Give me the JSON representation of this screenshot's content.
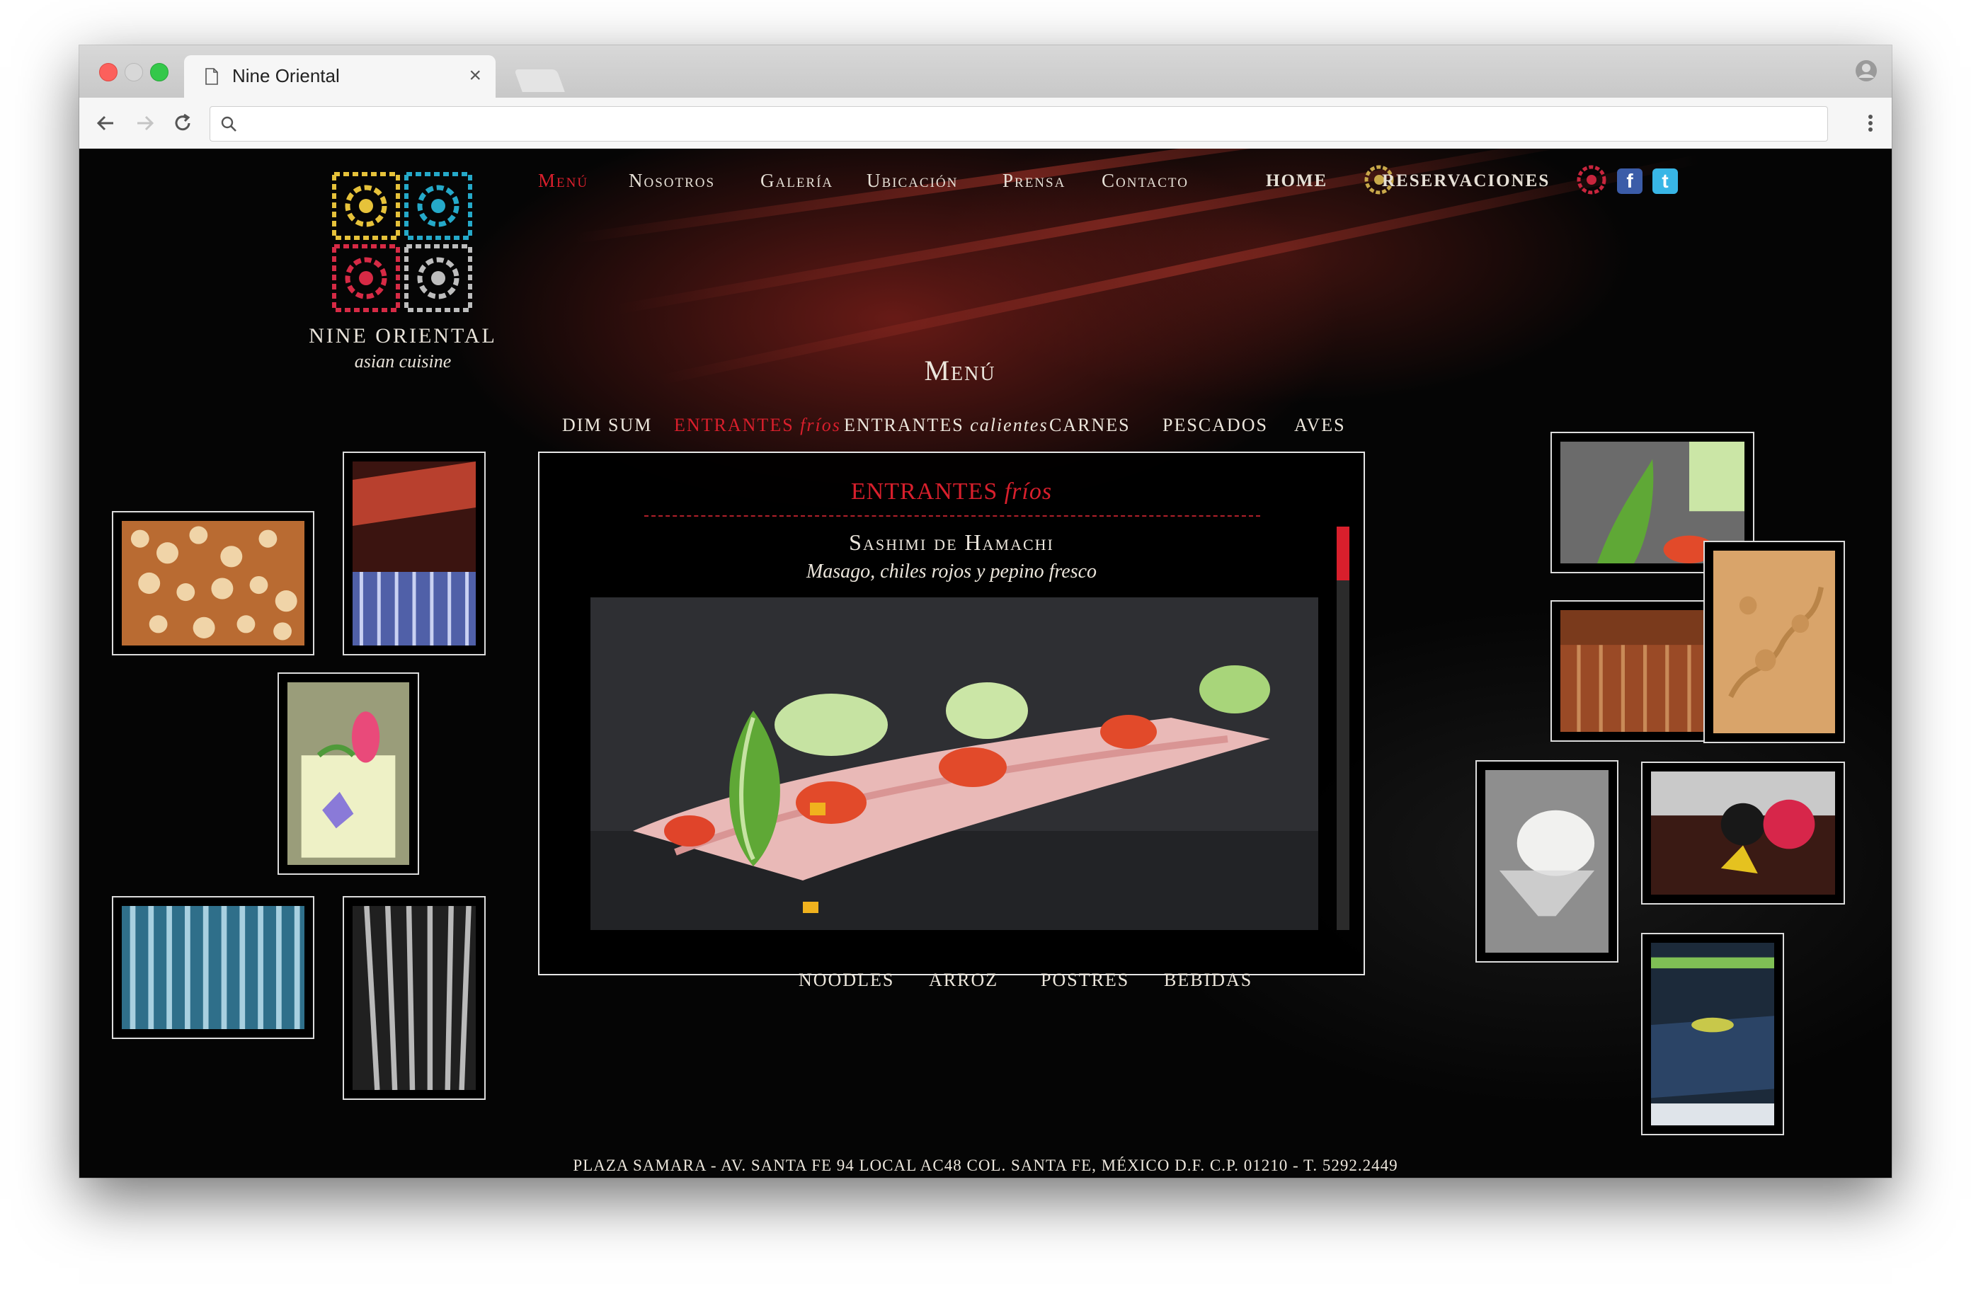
{
  "browser": {
    "tab_title": "Nine Oriental",
    "tab_close": "×",
    "url": "",
    "back_icon": "arrow-left-icon",
    "forward_icon": "arrow-right-icon",
    "reload_icon": "reload-icon",
    "search_icon": "search-icon",
    "menu_icon": "kebab-menu-icon",
    "profile_icon": "profile-icon"
  },
  "brand": {
    "name": "NINE ORIENTAL",
    "tagline": "asian cuisine",
    "colors": [
      "#e6c23a",
      "#25a9c9",
      "#d62a45",
      "#bdbdbd"
    ]
  },
  "top_nav": {
    "items": [
      {
        "label": "Menú",
        "active": true
      },
      {
        "label": "Nosotros",
        "active": false
      },
      {
        "label": "Galería",
        "active": false
      },
      {
        "label": "Ubicación",
        "active": false
      },
      {
        "label": "Prensa",
        "active": false
      },
      {
        "label": "Contacto",
        "active": false
      }
    ],
    "home": "HOME",
    "reservations": "RESERVACIONES",
    "facebook": "f",
    "twitter": "t"
  },
  "menu": {
    "heading": "Menú",
    "categories": [
      {
        "label": "DIM SUM",
        "italic": "",
        "active": false
      },
      {
        "label": "ENTRANTES",
        "italic": "fríos",
        "active": true
      },
      {
        "label": "ENTRANTES",
        "italic": "calientes",
        "active": false
      },
      {
        "label": "CARNES",
        "italic": "",
        "active": false
      },
      {
        "label": "PESCADOS",
        "italic": "",
        "active": false
      },
      {
        "label": "AVES",
        "italic": "",
        "active": false
      }
    ],
    "bottom_categories": [
      "NOODLES",
      "ARROZ",
      "POSTRES",
      "BEBIDAS"
    ],
    "panel": {
      "title": "ENTRANTES",
      "title_italic": "fríos",
      "dish_name": "Sashimi de Hamachi",
      "dish_desc": "Masago, chiles rojos y pepino fresco"
    }
  },
  "footer": {
    "address": "PLAZA SAMARA - AV. SANTA FE 94 LOCAL AC48 COL. SANTA FE, MÉXICO D.F. C.P. 01210   -   T. 5292.2449"
  },
  "accent_color": "#d81f2c"
}
